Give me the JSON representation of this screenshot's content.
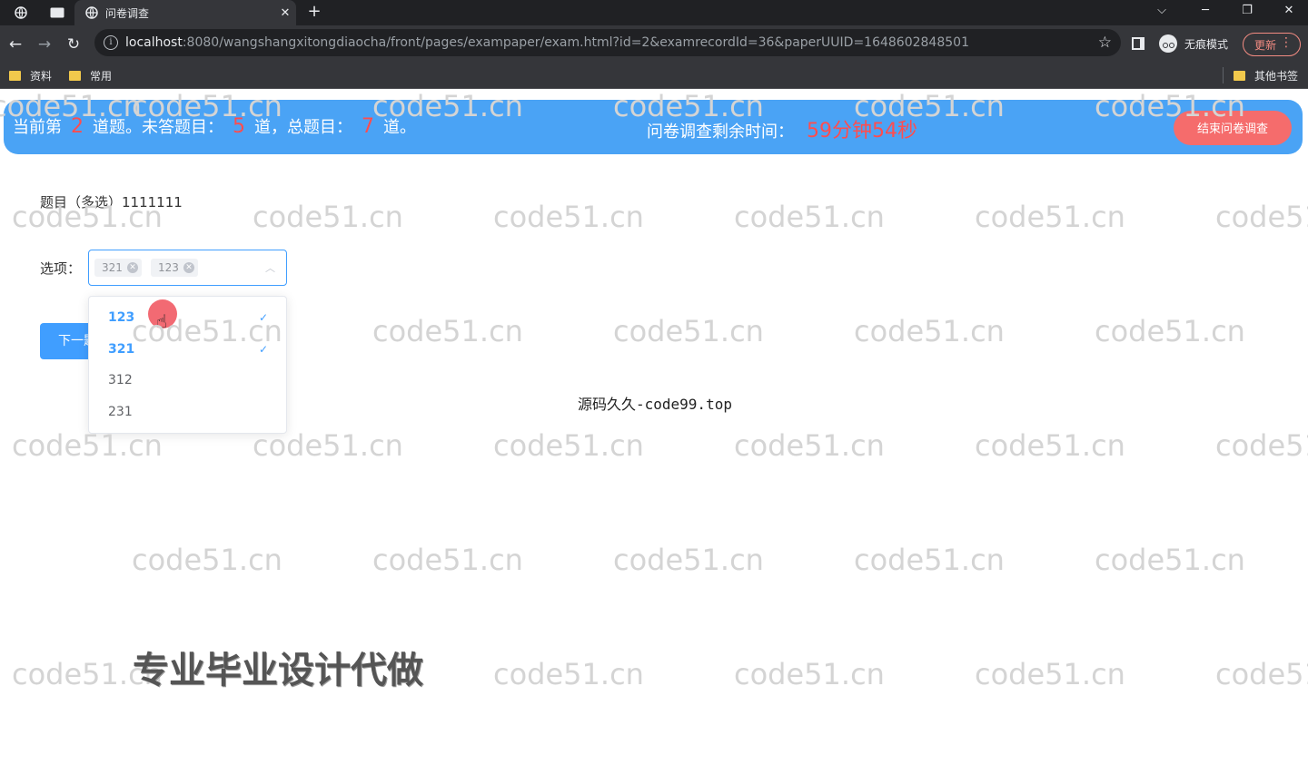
{
  "browser": {
    "tab_title": "问卷调查",
    "new_tab_label": "+",
    "url_host": "localhost",
    "url_rest": ":8080/wangshangxitongdiaocha/front/pages/exampaper/exam.html?id=2&examrecordId=36&paperUUID=1648602848501",
    "incognito_label": "无痕模式",
    "update_label": "更新",
    "bookmarks": [
      "资料",
      "常用"
    ],
    "other_bookmarks": "其他书签"
  },
  "status": {
    "current_prefix": "当前第",
    "current_num": "2",
    "unanswered_prefix": "道题。未答题目：",
    "unanswered_num": "5",
    "total_prefix": "道，总题目：",
    "total_num": "7",
    "total_suffix": "道。",
    "timer_label": "问卷调查剩余时间：",
    "timer_value": "59分钟54秒",
    "end_button": "结束问卷调查"
  },
  "question": {
    "title": "题目（多选）1111111",
    "options_label": "选项：",
    "selected_tags": [
      "321",
      "123"
    ],
    "options": [
      {
        "label": "123",
        "selected": true
      },
      {
        "label": "321",
        "selected": true
      },
      {
        "label": "312",
        "selected": false
      },
      {
        "label": "231",
        "selected": false
      }
    ],
    "next_button": "下一题"
  },
  "overlays": {
    "watermark_text": "code51.cn",
    "center_text": "源码久久-code99.top",
    "promo_text": "专业毕业设计代做"
  },
  "colors": {
    "status_bar": "#4aa3f5",
    "accent": "#409eff",
    "danger": "#f56c6c",
    "number_red": "#ff4d4f"
  }
}
